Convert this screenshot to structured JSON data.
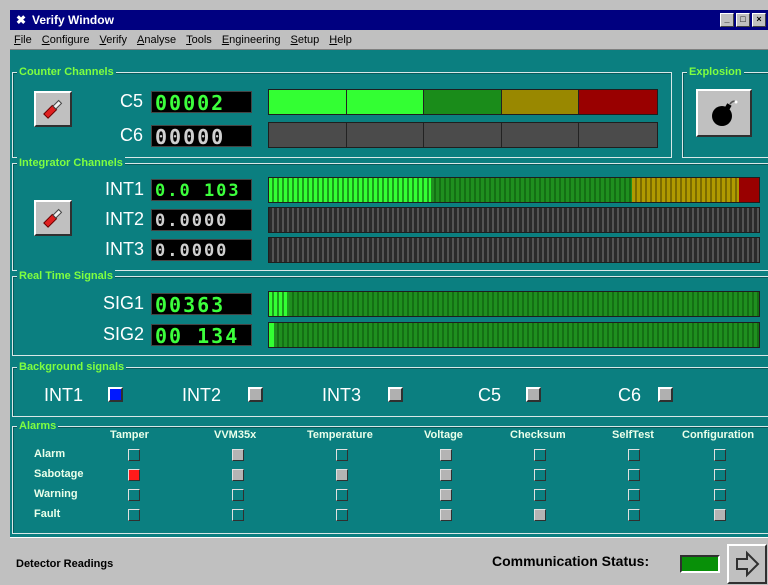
{
  "window": {
    "title": "Verify Window",
    "controls": [
      "_",
      "□",
      "×"
    ]
  },
  "menu": [
    "File",
    "Configure",
    "Verify",
    "Analyse",
    "Tools",
    "Engineering",
    "Setup",
    "Help"
  ],
  "counter": {
    "label": "Counter Channels",
    "channels": [
      {
        "name": "C5",
        "value": "00002"
      },
      {
        "name": "C6",
        "value": "00000"
      }
    ]
  },
  "explosion": {
    "label": "Explosion"
  },
  "integrator": {
    "label": "Integrator Channels",
    "channels": [
      {
        "name": "INT1",
        "value": "0.0 103"
      },
      {
        "name": "INT2",
        "value": "0.0000"
      },
      {
        "name": "INT3",
        "value": "0.0000"
      }
    ]
  },
  "realtime": {
    "label": "Real Time Signals",
    "channels": [
      {
        "name": "SIG1",
        "value": "00363"
      },
      {
        "name": "SIG2",
        "value": "00 134"
      }
    ]
  },
  "background": {
    "label": "Background signals",
    "items": [
      "INT1",
      "INT2",
      "INT3",
      "C5",
      "C6"
    ]
  },
  "alarms": {
    "label": "Alarms",
    "columns": [
      "Tamper",
      "VVM35x",
      "Temperature",
      "Voltage",
      "Checksum",
      "SelfTest",
      "Configuration"
    ],
    "rows": [
      "Alarm",
      "Sabotage",
      "Warning",
      "Fault"
    ]
  },
  "status": {
    "left": "Detector Readings",
    "communication": "Communication Status:"
  },
  "colors": {
    "panel": "#0b7f80",
    "lcd_green": "#3cff3c",
    "bar_bright_green": "#33ff33",
    "bar_dark_green": "#1a8c1a",
    "bar_olive": "#998800",
    "bar_red": "#990000",
    "alarm_red": "#ff1a1a",
    "bg_blue": "#0018ff"
  }
}
